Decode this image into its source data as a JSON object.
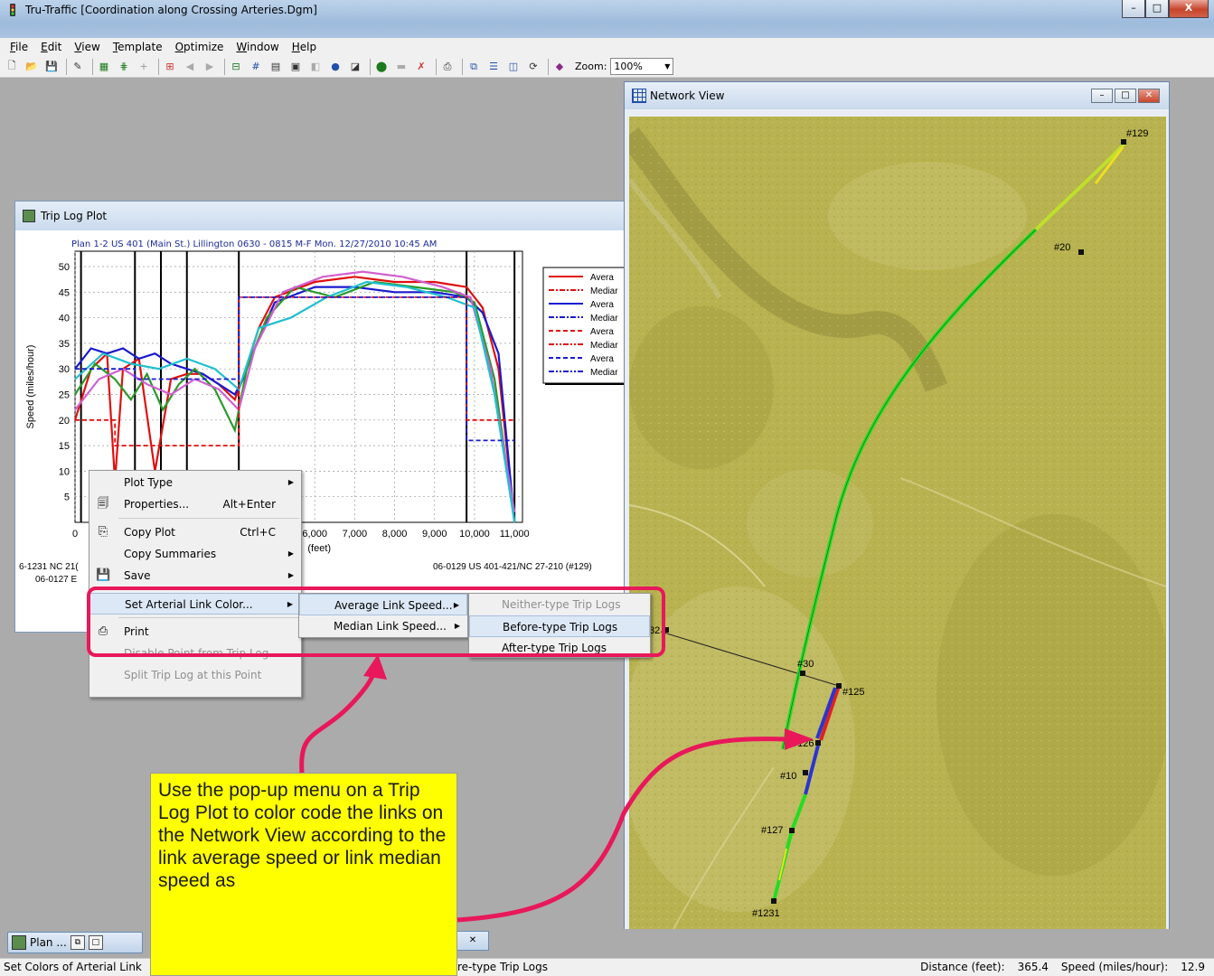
{
  "app": {
    "title": "Tru-Traffic [Coordination along Crossing Arteries.Dgm]",
    "window_buttons": [
      "–",
      "□",
      "X"
    ]
  },
  "menubar": [
    "File",
    "Edit",
    "View",
    "Template",
    "Optimize",
    "Window",
    "Help"
  ],
  "toolbar": {
    "zoom_label": "Zoom:",
    "zoom_value": "100%"
  },
  "trip_log_plot": {
    "title": "Trip Log Plot",
    "plot_title": "Plan 1-2 US 401 (Main St.) Lillington 0630 - 0815 M-F   Mon. 12/27/2010 10:45 AM",
    "xlabel_partial": "(feet)",
    "bottom_left_1": "6-1231 NC 21(",
    "bottom_left_2": "06-0127 E",
    "bottom_right_1": "06-0129 US 401-421/NC 27-210 (#129)",
    "legend": [
      "Avera",
      "Mediar",
      "Avera",
      "Mediar",
      "Avera",
      "Mediar",
      "Avera",
      "Mediar"
    ]
  },
  "chart_data": {
    "type": "line",
    "title": "Plan 1-2 US 401 (Main St.) Lillington 0630 - 0815 M-F   Mon. 12/27/2010 10:45 AM",
    "ylabel": "Speed (miles/hour)",
    "xlabel": "(feet)",
    "ylim": [
      0,
      53
    ],
    "xlim": [
      0,
      11200
    ],
    "yticks": [
      5,
      10,
      15,
      20,
      25,
      30,
      35,
      40,
      45,
      50
    ],
    "xtick_labels": [
      "0",
      "6,000",
      "7,000",
      "8,000",
      "9,000",
      "10,000",
      "11,000"
    ],
    "xtick_values": [
      0,
      6000,
      7000,
      8000,
      9000,
      10000,
      11000
    ],
    "intersections_x": [
      150,
      1500,
      2150,
      2800,
      4100,
      9800,
      11000
    ],
    "series": [
      {
        "color": "#e01010",
        "style": "solid",
        "x": [
          0,
          400,
          800,
          1000,
          1200,
          1600,
          2000,
          2400,
          2800,
          3200,
          3600,
          4000,
          4200,
          4600,
          5000,
          6000,
          7000,
          8000,
          9000,
          9800,
          10200,
          10600,
          11000
        ],
        "y": [
          20,
          30,
          33,
          8,
          30,
          32,
          10,
          28,
          29,
          29,
          27,
          24,
          28,
          38,
          44,
          47,
          48,
          47,
          47,
          46,
          42,
          30,
          0
        ]
      },
      {
        "color": "#1a1ad0",
        "style": "solid",
        "x": [
          0,
          400,
          800,
          1200,
          1600,
          2000,
          2400,
          2800,
          3200,
          3600,
          4000,
          4200,
          4600,
          5000,
          6000,
          7000,
          8000,
          9000,
          9800,
          10200,
          10600,
          11000
        ],
        "y": [
          30,
          34,
          33,
          34,
          32,
          33,
          31,
          30,
          29,
          27,
          25,
          28,
          36,
          43,
          46,
          46,
          45,
          45,
          44,
          41,
          33,
          0
        ]
      },
      {
        "color": "#2a9a2a",
        "style": "solid",
        "x": [
          0,
          500,
          1000,
          1400,
          1800,
          2200,
          2600,
          3000,
          3500,
          4000,
          4300,
          4800,
          5500,
          6500,
          7500,
          8500,
          9500,
          10000,
          10500,
          11000
        ],
        "y": [
          25,
          31,
          28,
          24,
          29,
          22,
          27,
          30,
          26,
          18,
          30,
          40,
          46,
          44,
          47,
          46,
          45,
          43,
          28,
          0
        ]
      },
      {
        "color": "#d060d0",
        "style": "solid",
        "x": [
          0,
          600,
          1200,
          1800,
          2400,
          3000,
          3600,
          4100,
          4500,
          5200,
          6200,
          7200,
          8200,
          9200,
          9900,
          10400,
          11000
        ],
        "y": [
          22,
          28,
          30,
          27,
          25,
          28,
          26,
          22,
          34,
          45,
          48,
          49,
          48,
          46,
          44,
          30,
          2
        ]
      },
      {
        "color": "#20c0d0",
        "style": "solid",
        "x": [
          0,
          700,
          1400,
          2100,
          2800,
          3500,
          4100,
          4600,
          5400,
          6300,
          7300,
          8300,
          9300,
          10000,
          10500,
          11000
        ],
        "y": [
          28,
          33,
          31,
          30,
          32,
          30,
          26,
          38,
          40,
          44,
          47,
          46,
          44,
          42,
          25,
          0
        ]
      },
      {
        "color": "#e01010",
        "style": "dashed",
        "x": [
          0,
          1000,
          1000,
          4100,
          4100,
          9800,
          9800,
          11000
        ],
        "y": [
          20,
          20,
          15,
          15,
          44,
          44,
          20,
          20
        ]
      },
      {
        "color": "#1a1ad0",
        "style": "dashed",
        "x": [
          0,
          1500,
          1500,
          4100,
          4100,
          9800,
          9800,
          11000
        ],
        "y": [
          30,
          30,
          28,
          28,
          44,
          44,
          16,
          16
        ]
      }
    ]
  },
  "context_menu": {
    "items": [
      {
        "label": "Plot Type",
        "shortcut": "",
        "submenu": true,
        "icon": "",
        "disabled": false
      },
      {
        "label": "Properties...",
        "shortcut": "Alt+Enter",
        "submenu": false,
        "icon": "properties-icon",
        "disabled": false
      },
      {
        "label": "Copy Plot",
        "shortcut": "Ctrl+C",
        "submenu": false,
        "icon": "copy-icon",
        "disabled": false
      },
      {
        "label": "Copy Summaries",
        "shortcut": "",
        "submenu": true,
        "icon": "",
        "disabled": false
      },
      {
        "label": "Save",
        "shortcut": "",
        "submenu": true,
        "icon": "save-icon",
        "disabled": false
      },
      {
        "label": "Set Arterial Link Color...",
        "shortcut": "",
        "submenu": true,
        "icon": "",
        "disabled": false
      },
      {
        "label": "Print",
        "shortcut": "",
        "submenu": false,
        "icon": "print-icon",
        "disabled": false
      },
      {
        "label": "Disable Point from Trip Log",
        "shortcut": "",
        "submenu": false,
        "icon": "",
        "disabled": true
      },
      {
        "label": "Split Trip Log at this Point",
        "shortcut": "",
        "submenu": false,
        "icon": "",
        "disabled": true
      }
    ]
  },
  "submenu_link_color": {
    "items": [
      "Average Link Speed...",
      "Median Link Speed..."
    ]
  },
  "submenu_trip_logs": {
    "items": [
      "Neither-type Trip Logs",
      "Before-type Trip Logs",
      "After-type Trip Logs"
    ]
  },
  "network_view": {
    "title": "Network View",
    "nodes": [
      "#129",
      "#20",
      "#30",
      "#125",
      "#126",
      "#10",
      "#127",
      "#1231",
      "32"
    ]
  },
  "callout": {
    "text": "Use the pop-up menu on a Trip Log Plot to color code the links on the Network View according to the link average speed or link median speed as"
  },
  "taskbar": {
    "item_label": "Plan ..."
  },
  "statusbar": {
    "left": "Set Colors of Arterial Link",
    "mid": "re-type Trip Logs",
    "distance_label": "Distance (feet):",
    "distance_value": "365.4",
    "speed_label": "Speed (miles/hour):",
    "speed_value": "12.9"
  }
}
